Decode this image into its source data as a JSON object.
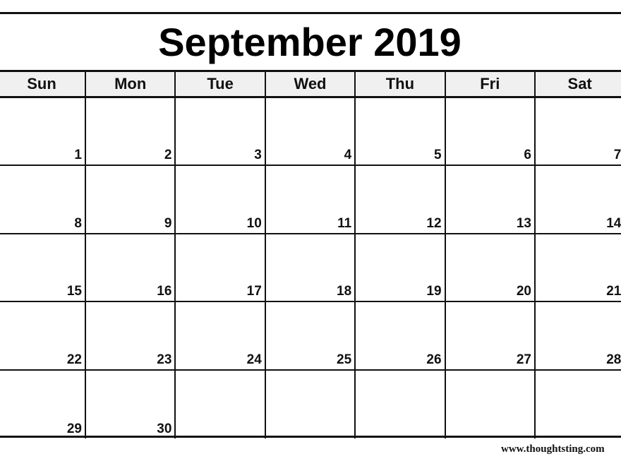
{
  "title": "September 2019",
  "weekdays": [
    "Sun",
    "Mon",
    "Tue",
    "Wed",
    "Thu",
    "Fri",
    "Sat"
  ],
  "weeks": [
    [
      "1",
      "2",
      "3",
      "4",
      "5",
      "6",
      "7"
    ],
    [
      "8",
      "9",
      "10",
      "11",
      "12",
      "13",
      "14"
    ],
    [
      "15",
      "16",
      "17",
      "18",
      "19",
      "20",
      "21"
    ],
    [
      "22",
      "23",
      "24",
      "25",
      "26",
      "27",
      "28"
    ],
    [
      "29",
      "30",
      "",
      "",
      "",
      "",
      ""
    ]
  ],
  "watermark": "www.thoughtsting.com",
  "colors": {
    "header_bg": "#f0f0f0",
    "lines": "#111111"
  }
}
